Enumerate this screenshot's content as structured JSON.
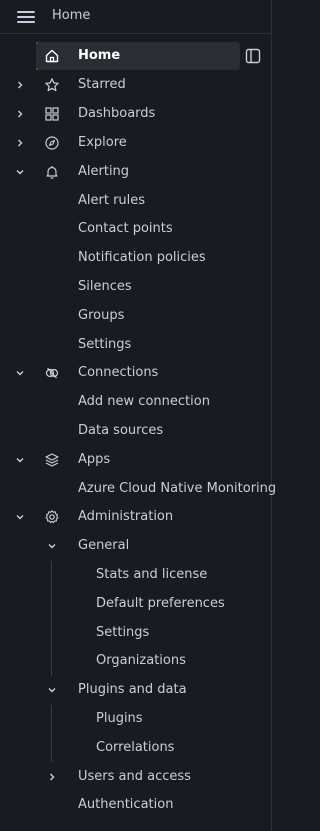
{
  "topbar": {
    "title": "Home",
    "menu_icon": "hamburger-icon"
  },
  "dock_icon": "dock-panel-icon",
  "nav": {
    "home": {
      "label": "Home",
      "icon": "home-icon",
      "active": true
    },
    "starred": {
      "label": "Starred",
      "icon": "star-icon",
      "expanded": false
    },
    "dashboards": {
      "label": "Dashboards",
      "icon": "apps-grid-icon",
      "expanded": false
    },
    "explore": {
      "label": "Explore",
      "icon": "compass-icon",
      "expanded": false
    },
    "alerting": {
      "label": "Alerting",
      "icon": "bell-icon",
      "expanded": true,
      "items": [
        "Alert rules",
        "Contact points",
        "Notification policies",
        "Silences",
        "Groups",
        "Settings"
      ]
    },
    "connections": {
      "label": "Connections",
      "icon": "link-icon",
      "expanded": true,
      "items": [
        "Add new connection",
        "Data sources"
      ]
    },
    "apps": {
      "label": "Apps",
      "icon": "layers-icon",
      "expanded": true,
      "items": [
        "Azure Cloud Native Monitoring"
      ]
    },
    "administration": {
      "label": "Administration",
      "icon": "cog-icon",
      "expanded": true,
      "general": {
        "label": "General",
        "expanded": true,
        "items": [
          "Stats and license",
          "Default preferences",
          "Settings",
          "Organizations"
        ]
      },
      "plugins": {
        "label": "Plugins and data",
        "expanded": true,
        "items": [
          "Plugins",
          "Correlations"
        ]
      },
      "users": {
        "label": "Users and access",
        "expanded": false
      },
      "authentication": {
        "label": "Authentication"
      }
    }
  },
  "colors": {
    "background": "#181b1f",
    "text": "#ccccdc",
    "active_bg": "#2a2d33",
    "accent": "#f26a27",
    "border": "#2c2f36"
  }
}
